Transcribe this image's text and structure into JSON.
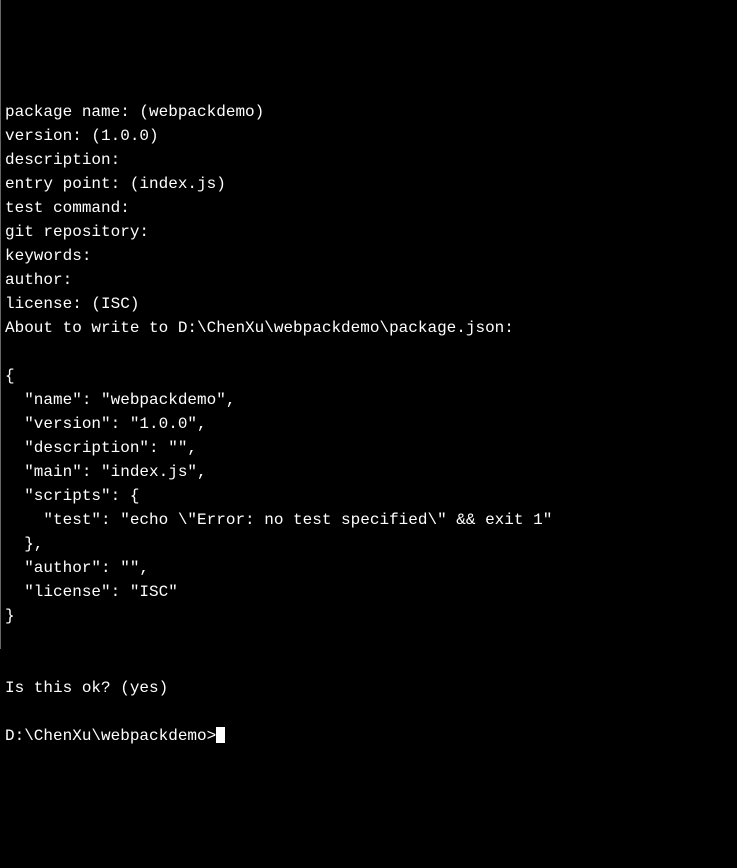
{
  "terminal": {
    "prompts": {
      "package_name": "package name: (webpackdemo)",
      "version": "version: (1.0.0)",
      "description": "description:",
      "entry_point": "entry point: (index.js)",
      "test_command": "test command:",
      "git_repository": "git repository:",
      "keywords": "keywords:",
      "author": "author:",
      "license": "license: (ISC)",
      "about_to_write": "About to write to D:\\ChenXu\\webpackdemo\\package.json:"
    },
    "json_output": {
      "open_brace": "{",
      "name_line": "  \"name\": \"webpackdemo\",",
      "version_line": "  \"version\": \"1.0.0\",",
      "description_line": "  \"description\": \"\",",
      "main_line": "  \"main\": \"index.js\",",
      "scripts_open": "  \"scripts\": {",
      "test_line": "    \"test\": \"echo \\\"Error: no test specified\\\" && exit 1\"",
      "scripts_close": "  },",
      "author_line": "  \"author\": \"\",",
      "license_line": "  \"license\": \"ISC\"",
      "close_brace": "}"
    },
    "confirm": "Is this ok? (yes)",
    "command_prompt": "D:\\ChenXu\\webpackdemo>"
  }
}
